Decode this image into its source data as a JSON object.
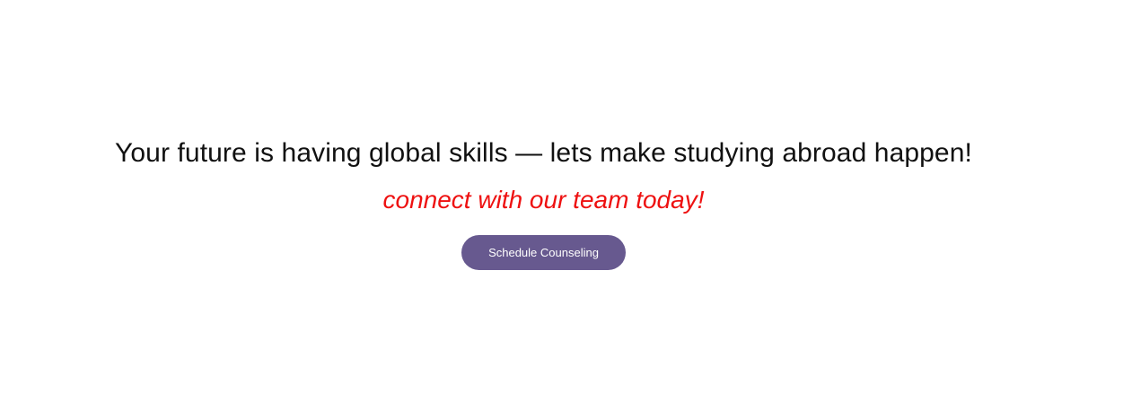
{
  "cta": {
    "headline": "Your future is having global skills — lets make studying abroad happen!",
    "subline": "connect with our team today!",
    "button_label": "Schedule Counseling"
  },
  "colors": {
    "headline_text": "#111111",
    "subline_text": "#ee1111",
    "button_background": "#67598f",
    "button_text": "#ffffff",
    "page_background": "#ffffff"
  }
}
